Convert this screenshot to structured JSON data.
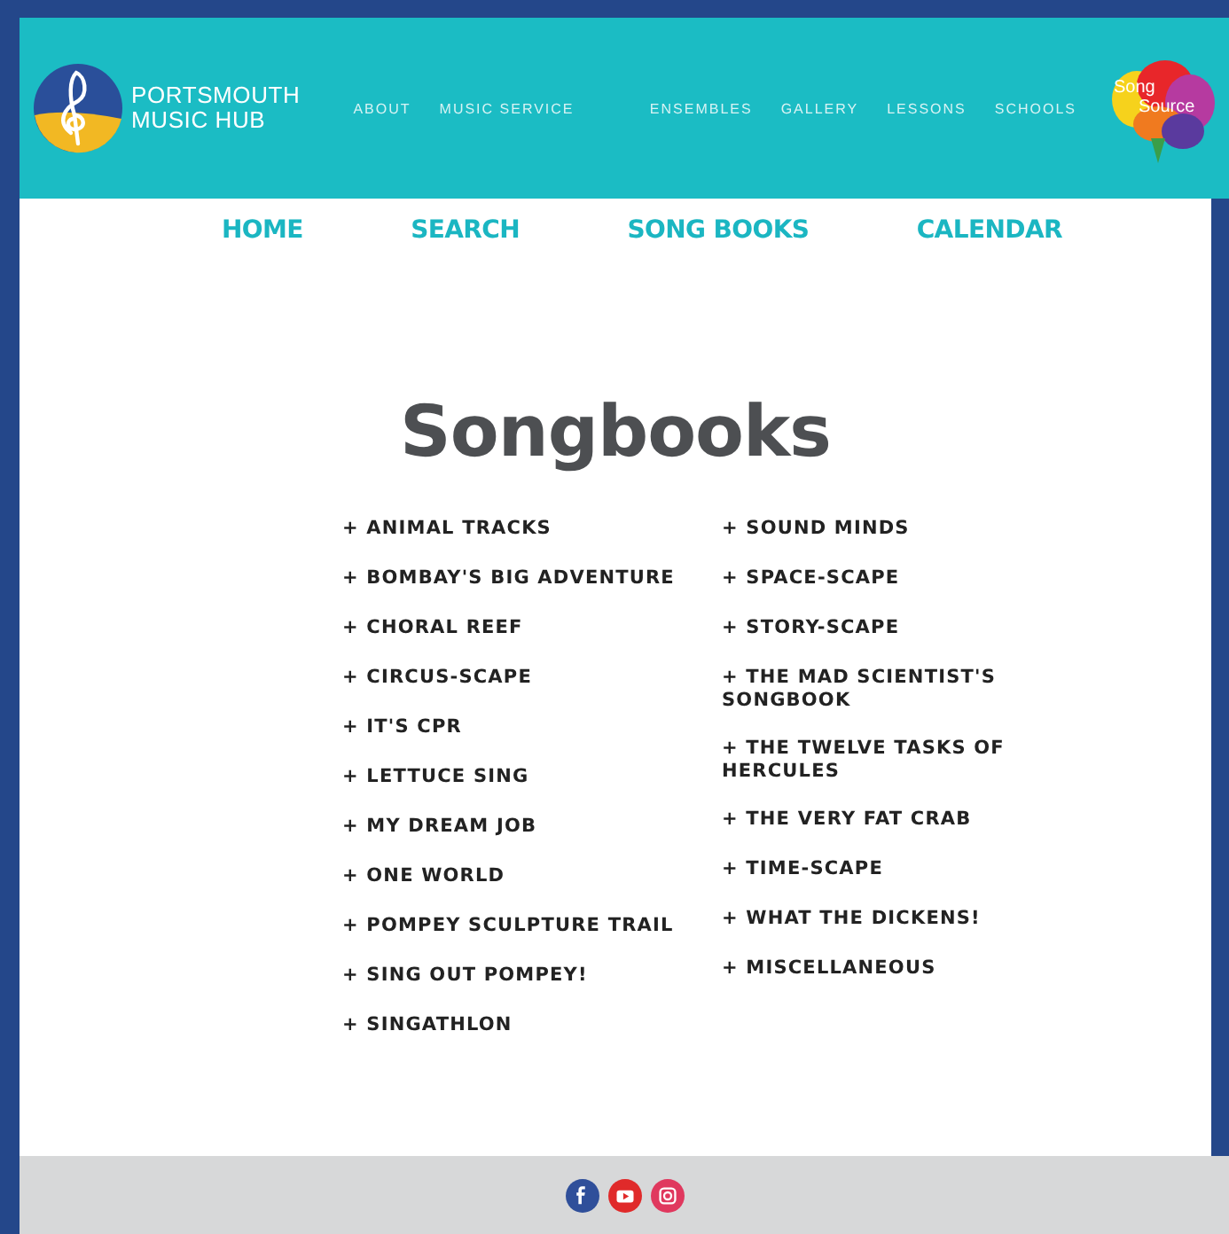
{
  "header": {
    "brand": [
      "PORTSMOUTH",
      "MUSIC HUB"
    ],
    "nav_left": [
      "ABOUT",
      "MUSIC SERVICE"
    ],
    "nav_right": [
      "ENSEMBLES",
      "GALLERY",
      "LESSONS",
      "SCHOOLS"
    ],
    "partner_logo": [
      "Song",
      "Source"
    ]
  },
  "subnav": [
    "HOME",
    "SEARCH",
    "SONG BOOKS",
    "CALENDAR"
  ],
  "title": "Songbooks",
  "columns": [
    [
      "+ ANIMAL TRACKS",
      "+ BOMBAY'S BIG ADVENTURE",
      "+ CHORAL REEF",
      "+ CIRCUS-SCAPE",
      "+ IT'S CPR",
      "+ LETTUCE SING",
      "+ MY DREAM JOB",
      "+ ONE WORLD",
      "+ POMPEY SCULPTURE TRAIL",
      "+ SING OUT POMPEY!",
      "+ SINGATHLON"
    ],
    [
      "+ SOUND MINDS",
      "+ SPACE-SCAPE",
      "+ STORY-SCAPE",
      "+ THE MAD SCIENTIST'S SONGBOOK",
      "+ THE TWELVE TASKS OF HERCULES",
      "+ THE VERY FAT CRAB",
      "+ TIME-SCAPE",
      "+ WHAT THE DICKENS!",
      "+ MISCELLANEOUS"
    ]
  ],
  "footer": {
    "social": [
      {
        "kind": "facebook",
        "color": "#2f4f9a"
      },
      {
        "kind": "youtube",
        "color": "#e02a2a"
      },
      {
        "kind": "instagram",
        "color": "#e0385e"
      }
    ]
  }
}
